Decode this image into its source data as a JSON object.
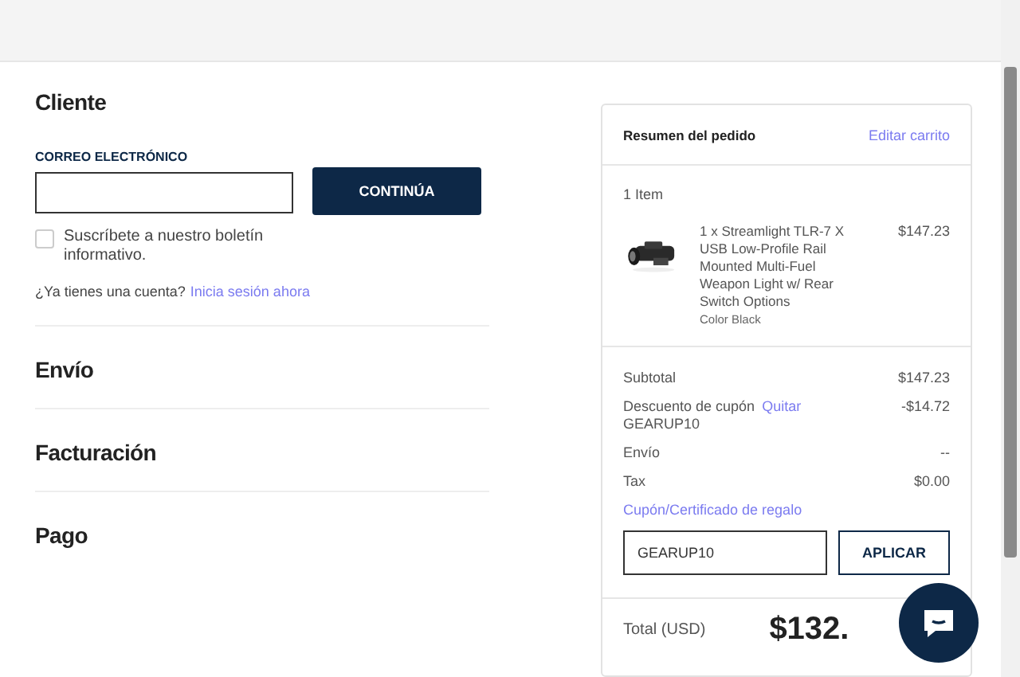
{
  "customer": {
    "title": "Cliente",
    "email_label": "CORREO ELECTRÓNICO",
    "continue_button": "CONTINÚA",
    "newsletter": {
      "label": "Suscríbete a nuestro boletín informativo.",
      "checked": false
    },
    "account_prompt": "¿Ya tienes una cuenta?",
    "sign_in_link": "Inicia sesión ahora"
  },
  "steps": [
    "Envío",
    "Facturación",
    "Pago"
  ],
  "order_summary": {
    "title": "Resumen del pedido",
    "edit_link": "Editar carrito",
    "item_count": "1 Item",
    "items": [
      {
        "name": "1 x Streamlight TLR-7 X USB Low-Profile Rail Mounted Multi-Fuel Weapon Light w/ Rear Switch Options",
        "option": "Color Black",
        "price": "$147.23"
      }
    ],
    "lines": [
      {
        "label": "Subtotal",
        "value": "$147.23"
      },
      {
        "label": "Descuento de cupón",
        "action": "Quitar",
        "code": "GEARUP10",
        "value": "-$14.72"
      },
      {
        "label": "Envío",
        "value": "--"
      },
      {
        "label": "Tax",
        "value": "$0.00"
      }
    ],
    "coupon_link": "Cupón/Certificado de regalo",
    "coupon": {
      "value": "GEARUP10",
      "button": "APLICAR"
    },
    "total_label": "Total (USD)",
    "total": "$132."
  }
}
